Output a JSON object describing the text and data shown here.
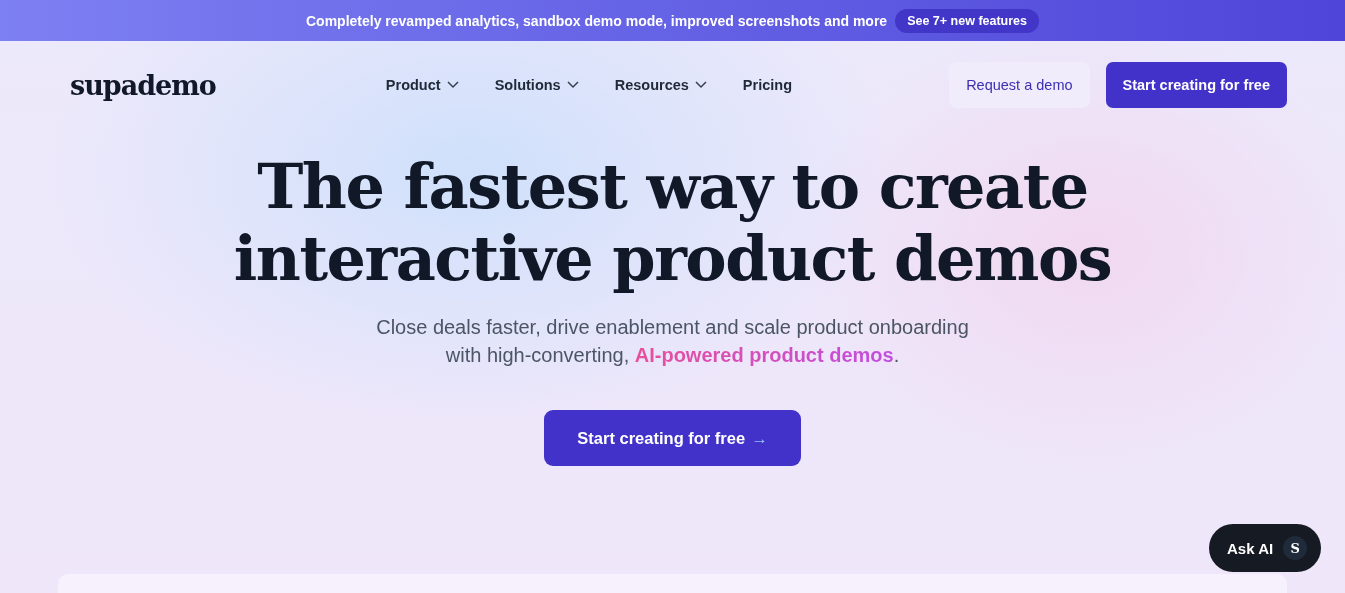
{
  "announcement": {
    "text": "Completely revamped analytics, sandbox demo mode, improved screenshots and more",
    "link": "See 7+ new features"
  },
  "nav": {
    "logo": "supademo",
    "items": [
      {
        "label": "Product",
        "kind": "dropdown"
      },
      {
        "label": "Solutions",
        "kind": "dropdown"
      },
      {
        "label": "Resources",
        "kind": "dropdown"
      },
      {
        "label": "Pricing",
        "kind": "link"
      }
    ],
    "secondary_button": "Request a demo",
    "primary_button": "Start creating for free"
  },
  "hero": {
    "headline_lines": [
      "The fastest way to create",
      "interactive product demos"
    ],
    "subtitle_lines": [
      "Close deals faster, drive enablement and scale product onboarding",
      "with high-converting, **AI-powered product demos**."
    ],
    "cta": "Start creating for free",
    "cta_arrow": "→"
  },
  "ask_ai": {
    "label": "Ask AI",
    "badge": "S"
  }
}
